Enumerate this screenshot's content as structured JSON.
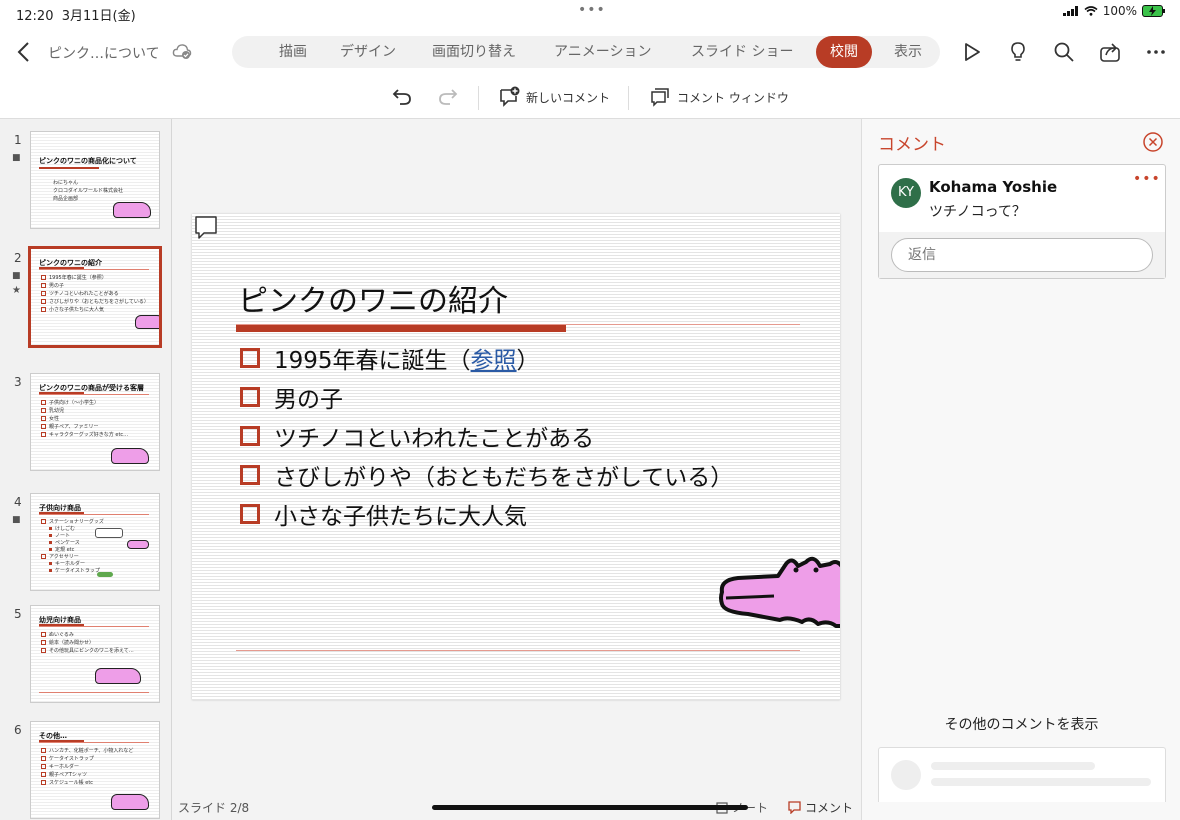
{
  "status_bar": {
    "time": "12:20",
    "date": "3月11日(金)",
    "dots": "•••",
    "battery": "100%"
  },
  "header": {
    "title": "ピンク…について",
    "tabs": [
      {
        "label": "描画"
      },
      {
        "label": "デザイン"
      },
      {
        "label": "画面切り替え"
      },
      {
        "label": "アニメーション"
      },
      {
        "label": "スライド ショー"
      },
      {
        "label": "校閲",
        "active": true
      },
      {
        "label": "表示"
      }
    ],
    "accent": "#b83c25"
  },
  "toolbar": {
    "new_comment": "新しいコメント",
    "comment_window": "コメント ウィンドウ"
  },
  "thumbnails": [
    {
      "num": "1",
      "title": "ピンクのワニの商品化について",
      "lines": [
        "わにちゃん",
        "クロコダイルワールド株式会社",
        "商品企画部"
      ]
    },
    {
      "num": "2",
      "title": "ピンクのワニの紹介",
      "lines": [
        "1995年春に誕生（参照）",
        "男の子",
        "ツチノコといわれたことがある",
        "さびしがりや（おともだちをさがしている）",
        "小さな子供たちに大人気"
      ]
    },
    {
      "num": "3",
      "title": "ピンクのワニの商品が受ける客層",
      "lines": [
        "子供向け（〜小学生）",
        "乳幼児",
        "女性",
        "親子ペア、ファミリー",
        "キャラクターグッズ好きな方 etc…"
      ]
    },
    {
      "num": "4",
      "title": "子供向け商品",
      "lines": [
        "ステーショナリーグッズ",
        "けしごむ",
        "ノート",
        "ペンケース",
        "定規 etc",
        "アクセサリー",
        "キーホルダー",
        "ケータイストラップ"
      ]
    },
    {
      "num": "5",
      "title": "幼児向け商品",
      "lines": [
        "ぬいぐるみ",
        "絵本（読み聞かせ）",
        "その他玩具にピンクのワニを添えて…"
      ]
    },
    {
      "num": "6",
      "title": "その他…",
      "lines": [
        "ハンカチ、化粧ポーチ、小物入れなど",
        "ケータイストラップ",
        "キーホルダー",
        "親子ペアTシャツ",
        "スケジュール帳 etc"
      ]
    }
  ],
  "slide": {
    "title": "ピンクのワニの紹介",
    "bullets": [
      {
        "before": "1995年春に誕生（",
        "link": "参照",
        "after": "）"
      },
      {
        "before": "男の子"
      },
      {
        "before": "ツチノコといわれたことがある"
      },
      {
        "before": "さびしがりや（おともだちをさがしている）"
      },
      {
        "before": "小さな子供たちに大人気"
      }
    ]
  },
  "footer": {
    "slide_count": "スライド 2/8",
    "notes": "ノート",
    "comments": "コメント"
  },
  "comments_panel": {
    "title": "コメント",
    "comment": {
      "initials": "KY",
      "author": "Kohama Yoshie",
      "text": "ツチノコって？",
      "more": "•••"
    },
    "reply_placeholder": "返信",
    "show_more": "その他のコメントを表示"
  }
}
